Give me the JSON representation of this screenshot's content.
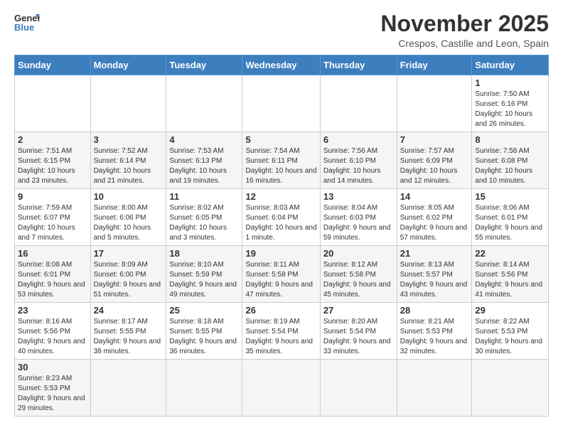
{
  "logo": {
    "line1": "General",
    "line2": "Blue"
  },
  "title": "November 2025",
  "subtitle": "Crespos, Castille and Leon, Spain",
  "days_of_week": [
    "Sunday",
    "Monday",
    "Tuesday",
    "Wednesday",
    "Thursday",
    "Friday",
    "Saturday"
  ],
  "weeks": [
    [
      {
        "day": "",
        "info": ""
      },
      {
        "day": "",
        "info": ""
      },
      {
        "day": "",
        "info": ""
      },
      {
        "day": "",
        "info": ""
      },
      {
        "day": "",
        "info": ""
      },
      {
        "day": "",
        "info": ""
      },
      {
        "day": "1",
        "info": "Sunrise: 7:50 AM\nSunset: 6:16 PM\nDaylight: 10 hours\nand 26 minutes."
      }
    ],
    [
      {
        "day": "2",
        "info": "Sunrise: 7:51 AM\nSunset: 6:15 PM\nDaylight: 10 hours\nand 23 minutes."
      },
      {
        "day": "3",
        "info": "Sunrise: 7:52 AM\nSunset: 6:14 PM\nDaylight: 10 hours\nand 21 minutes."
      },
      {
        "day": "4",
        "info": "Sunrise: 7:53 AM\nSunset: 6:13 PM\nDaylight: 10 hours\nand 19 minutes."
      },
      {
        "day": "5",
        "info": "Sunrise: 7:54 AM\nSunset: 6:11 PM\nDaylight: 10 hours\nand 16 minutes."
      },
      {
        "day": "6",
        "info": "Sunrise: 7:56 AM\nSunset: 6:10 PM\nDaylight: 10 hours\nand 14 minutes."
      },
      {
        "day": "7",
        "info": "Sunrise: 7:57 AM\nSunset: 6:09 PM\nDaylight: 10 hours\nand 12 minutes."
      },
      {
        "day": "8",
        "info": "Sunrise: 7:58 AM\nSunset: 6:08 PM\nDaylight: 10 hours\nand 10 minutes."
      }
    ],
    [
      {
        "day": "9",
        "info": "Sunrise: 7:59 AM\nSunset: 6:07 PM\nDaylight: 10 hours\nand 7 minutes."
      },
      {
        "day": "10",
        "info": "Sunrise: 8:00 AM\nSunset: 6:06 PM\nDaylight: 10 hours\nand 5 minutes."
      },
      {
        "day": "11",
        "info": "Sunrise: 8:02 AM\nSunset: 6:05 PM\nDaylight: 10 hours\nand 3 minutes."
      },
      {
        "day": "12",
        "info": "Sunrise: 8:03 AM\nSunset: 6:04 PM\nDaylight: 10 hours\nand 1 minute."
      },
      {
        "day": "13",
        "info": "Sunrise: 8:04 AM\nSunset: 6:03 PM\nDaylight: 9 hours\nand 59 minutes."
      },
      {
        "day": "14",
        "info": "Sunrise: 8:05 AM\nSunset: 6:02 PM\nDaylight: 9 hours\nand 57 minutes."
      },
      {
        "day": "15",
        "info": "Sunrise: 8:06 AM\nSunset: 6:01 PM\nDaylight: 9 hours\nand 55 minutes."
      }
    ],
    [
      {
        "day": "16",
        "info": "Sunrise: 8:08 AM\nSunset: 6:01 PM\nDaylight: 9 hours\nand 53 minutes."
      },
      {
        "day": "17",
        "info": "Sunrise: 8:09 AM\nSunset: 6:00 PM\nDaylight: 9 hours\nand 51 minutes."
      },
      {
        "day": "18",
        "info": "Sunrise: 8:10 AM\nSunset: 5:59 PM\nDaylight: 9 hours\nand 49 minutes."
      },
      {
        "day": "19",
        "info": "Sunrise: 8:11 AM\nSunset: 5:58 PM\nDaylight: 9 hours\nand 47 minutes."
      },
      {
        "day": "20",
        "info": "Sunrise: 8:12 AM\nSunset: 5:58 PM\nDaylight: 9 hours\nand 45 minutes."
      },
      {
        "day": "21",
        "info": "Sunrise: 8:13 AM\nSunset: 5:57 PM\nDaylight: 9 hours\nand 43 minutes."
      },
      {
        "day": "22",
        "info": "Sunrise: 8:14 AM\nSunset: 5:56 PM\nDaylight: 9 hours\nand 41 minutes."
      }
    ],
    [
      {
        "day": "23",
        "info": "Sunrise: 8:16 AM\nSunset: 5:56 PM\nDaylight: 9 hours\nand 40 minutes."
      },
      {
        "day": "24",
        "info": "Sunrise: 8:17 AM\nSunset: 5:55 PM\nDaylight: 9 hours\nand 38 minutes."
      },
      {
        "day": "25",
        "info": "Sunrise: 8:18 AM\nSunset: 5:55 PM\nDaylight: 9 hours\nand 36 minutes."
      },
      {
        "day": "26",
        "info": "Sunrise: 8:19 AM\nSunset: 5:54 PM\nDaylight: 9 hours\nand 35 minutes."
      },
      {
        "day": "27",
        "info": "Sunrise: 8:20 AM\nSunset: 5:54 PM\nDaylight: 9 hours\nand 33 minutes."
      },
      {
        "day": "28",
        "info": "Sunrise: 8:21 AM\nSunset: 5:53 PM\nDaylight: 9 hours\nand 32 minutes."
      },
      {
        "day": "29",
        "info": "Sunrise: 8:22 AM\nSunset: 5:53 PM\nDaylight: 9 hours\nand 30 minutes."
      }
    ],
    [
      {
        "day": "30",
        "info": "Sunrise: 8:23 AM\nSunset: 5:53 PM\nDaylight: 9 hours\nand 29 minutes."
      },
      {
        "day": "",
        "info": ""
      },
      {
        "day": "",
        "info": ""
      },
      {
        "day": "",
        "info": ""
      },
      {
        "day": "",
        "info": ""
      },
      {
        "day": "",
        "info": ""
      },
      {
        "day": "",
        "info": ""
      }
    ]
  ]
}
